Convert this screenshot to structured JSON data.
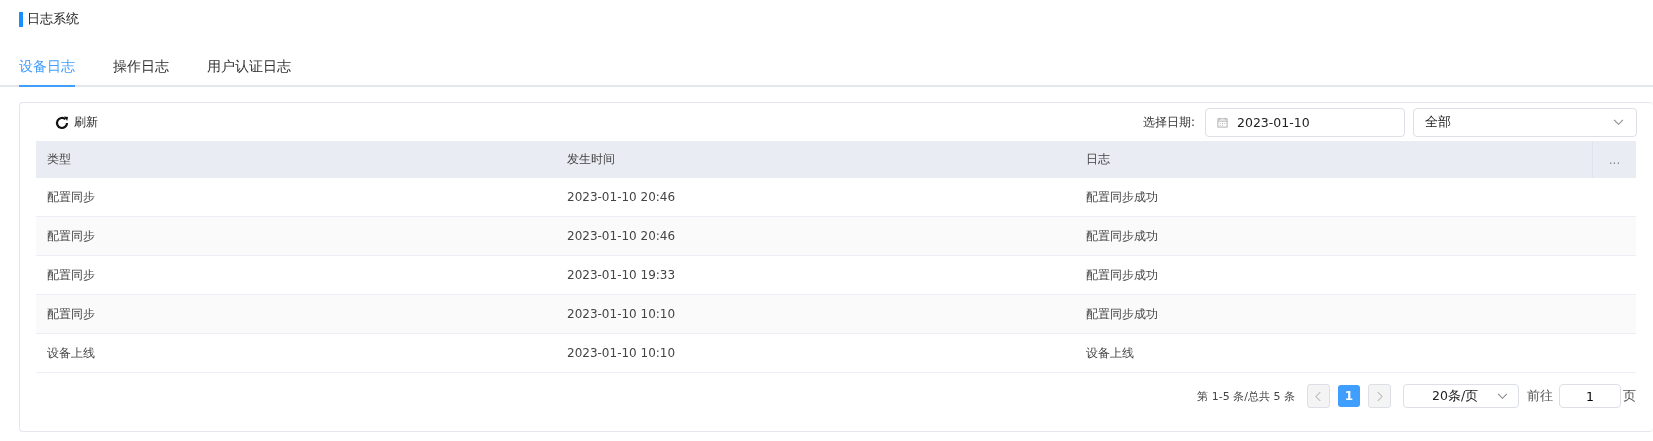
{
  "page_title": "日志系统",
  "tabs": [
    {
      "label": "设备日志",
      "selected": true
    },
    {
      "label": "操作日志",
      "selected": false
    },
    {
      "label": "用户认证日志",
      "selected": false
    }
  ],
  "toolbar": {
    "refresh_label": "刷新",
    "date_label": "选择日期:",
    "date_value": "2023-01-10",
    "filter_value": "全部"
  },
  "table": {
    "columns": [
      "类型",
      "发生时间",
      "日志",
      "..."
    ],
    "rows": [
      {
        "cells": [
          "配置同步",
          "2023-01-10 20:46",
          "配置同步成功"
        ]
      },
      {
        "cells": [
          "配置同步",
          "2023-01-10 20:46",
          "配置同步成功"
        ]
      },
      {
        "cells": [
          "配置同步",
          "2023-01-10 19:33",
          "配置同步成功"
        ]
      },
      {
        "cells": [
          "配置同步",
          "2023-01-10 10:10",
          "配置同步成功"
        ]
      },
      {
        "cells": [
          "设备上线",
          "2023-01-10 10:10",
          "设备上线"
        ]
      }
    ]
  },
  "pagination": {
    "summary": "第 1-5 条/总共 5 条",
    "prev_disabled": true,
    "next_disabled": true,
    "pages": [
      {
        "label": "1",
        "selected": true
      }
    ],
    "page_size": "20条/页",
    "goto_label": "前往",
    "goto_value": "1",
    "page_suffix": "页"
  }
}
